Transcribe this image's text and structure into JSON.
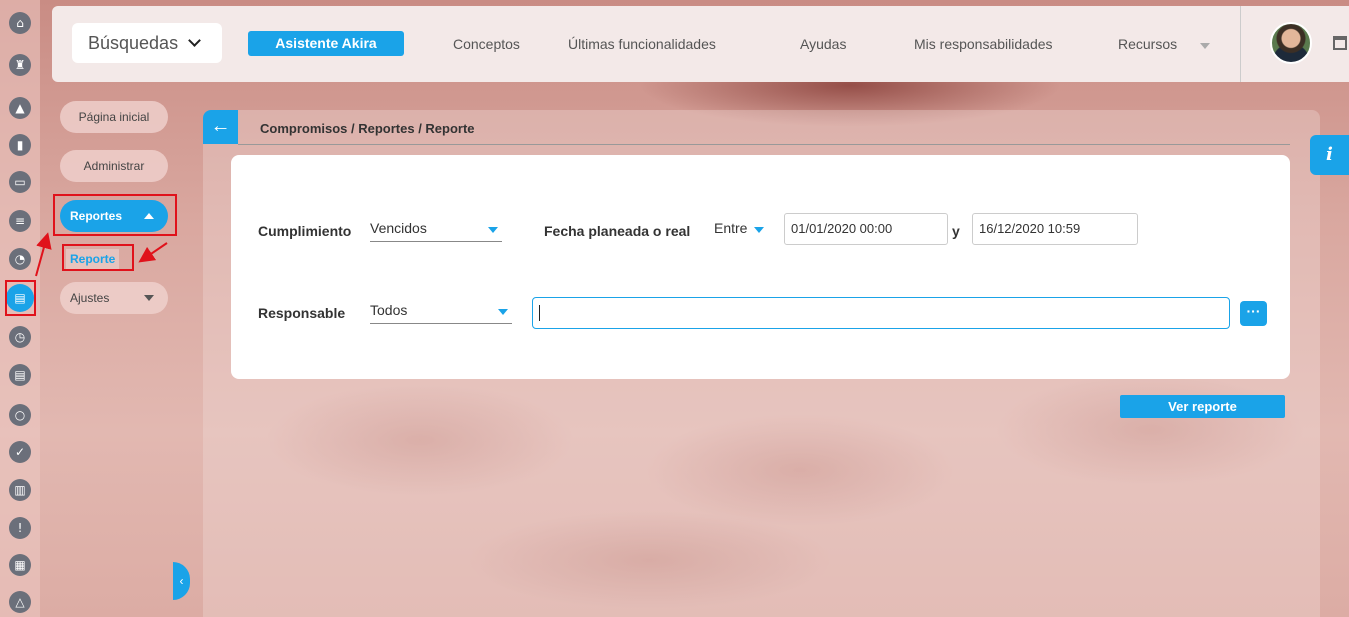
{
  "topbar": {
    "search_label": "Búsquedas",
    "assistant_label": "Asistente Akira",
    "nav_items": [
      "Conceptos",
      "Últimas funcionalidades",
      "Ayudas",
      "Mis responsabilidades",
      "Recursos"
    ]
  },
  "icon_rail": {
    "icons": [
      "home-icon",
      "chess-rook-icon",
      "pyramid-icon",
      "bar-chart-icon",
      "presentation-icon",
      "list-icon",
      "pie-chart-icon",
      "reports-book-icon",
      "clock-icon",
      "document-icon",
      "cycle-icon",
      "check-icon",
      "briefcase-icon",
      "warning-icon",
      "calendar-icon",
      "network-icon"
    ]
  },
  "sub_nav": {
    "home": "Página inicial",
    "admin": "Administrar",
    "reportes": "Reportes",
    "reporte": "Reporte",
    "ajustes": "Ajustes"
  },
  "breadcrumb": "Compromisos / Reportes / Reporte",
  "info_label": "i",
  "form": {
    "cumplimiento_label": "Cumplimiento",
    "cumplimiento_value": "Vencidos",
    "fecha_label": "Fecha planeada o real",
    "fecha_mode": "Entre",
    "fecha_from": "01/01/2020 00:00",
    "y_label": "y",
    "fecha_to": "16/12/2020 10:59",
    "responsable_label": "Responsable",
    "responsable_value": "Todos",
    "responsable_text": "",
    "dots_label": "···"
  },
  "ver_reporte": "Ver reporte",
  "colors": {
    "accent": "#1aa3e8",
    "highlight": "#e0121b"
  }
}
